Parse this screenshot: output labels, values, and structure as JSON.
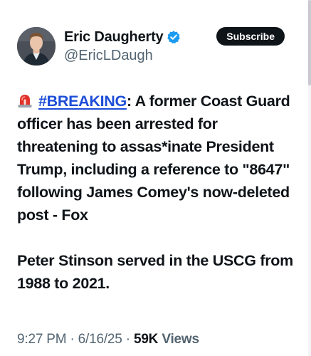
{
  "author": {
    "display_name": "Eric Daugherty",
    "handle": "@EricLDaugh",
    "verified": true,
    "avatar_icon": "person-avatar"
  },
  "subscribe_label": "Subscribe",
  "tweet": {
    "emoji": "siren-icon",
    "hashtag": "#BREAKING",
    "text_after_hashtag": ": A former Coast Guard officer has been arrested for threatening to assas*inate President Trump, including a reference to \"8647\" following James Comey's now-deleted post - Fox",
    "paragraph_2": "Peter Stinson served in the USCG from 1988 to 2021."
  },
  "meta": {
    "time": "9:27 PM",
    "date": "6/16/25",
    "separator": " · ",
    "views_count": "59K",
    "views_label": "Views"
  },
  "colors": {
    "text": "#0f1419",
    "secondary": "#536471",
    "link": "#1d4ed8",
    "verified": "#1d9bf0",
    "button_bg": "#0f1419"
  }
}
